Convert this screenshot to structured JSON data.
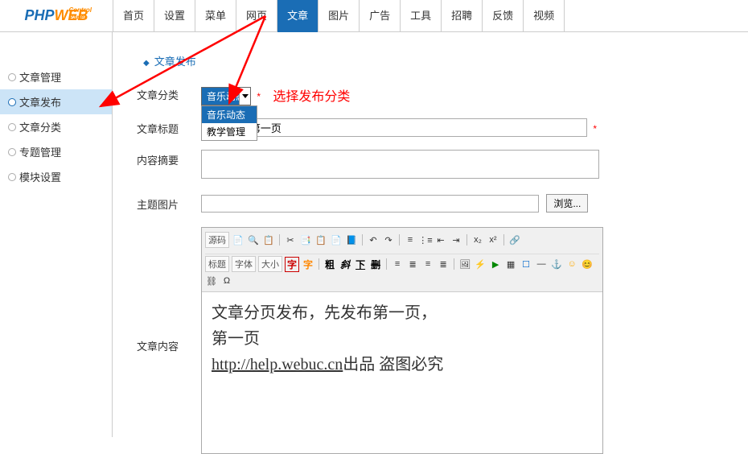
{
  "logo": {
    "php": "PHP",
    "web": "WEB",
    "sub": "Control Panel"
  },
  "top_nav": {
    "items": [
      "首页",
      "设置",
      "菜单",
      "网页",
      "文章",
      "图片",
      "广告",
      "工具",
      "招聘",
      "反馈",
      "视频"
    ],
    "active_index": 4
  },
  "sidebar": {
    "items": [
      "文章管理",
      "文章发布",
      "文章分类",
      "专题管理",
      "模块设置"
    ],
    "active_index": 1
  },
  "breadcrumb": "文章发布",
  "form": {
    "category": {
      "label": "文章分类",
      "selected": "音乐动态",
      "options": [
        "音乐动态",
        "教学管理"
      ],
      "highlighted_index": 0,
      "annotation": "选择发布分类",
      "required": "*"
    },
    "title": {
      "label": "文章标题",
      "value": "i，先发布第一页",
      "required": "*"
    },
    "summary": {
      "label": "内容摘要",
      "value": ""
    },
    "image": {
      "label": "主题图片",
      "value": "",
      "browse": "浏览..."
    },
    "content": {
      "label": "文章内容",
      "toolbar": {
        "source": "源码",
        "title_btn": "标题",
        "font_btn": "字体",
        "size_btn": "大小",
        "char1": "字",
        "char2": "字",
        "bold": "粗",
        "italic": "斜",
        "underline": "下",
        "strike": "删"
      },
      "body": {
        "line1": "文章分页发布，先发布第一页，",
        "line2": "第一页",
        "line3_link": "http://help.webuc.cn",
        "line3_text": "出品  盗图必究"
      }
    }
  }
}
